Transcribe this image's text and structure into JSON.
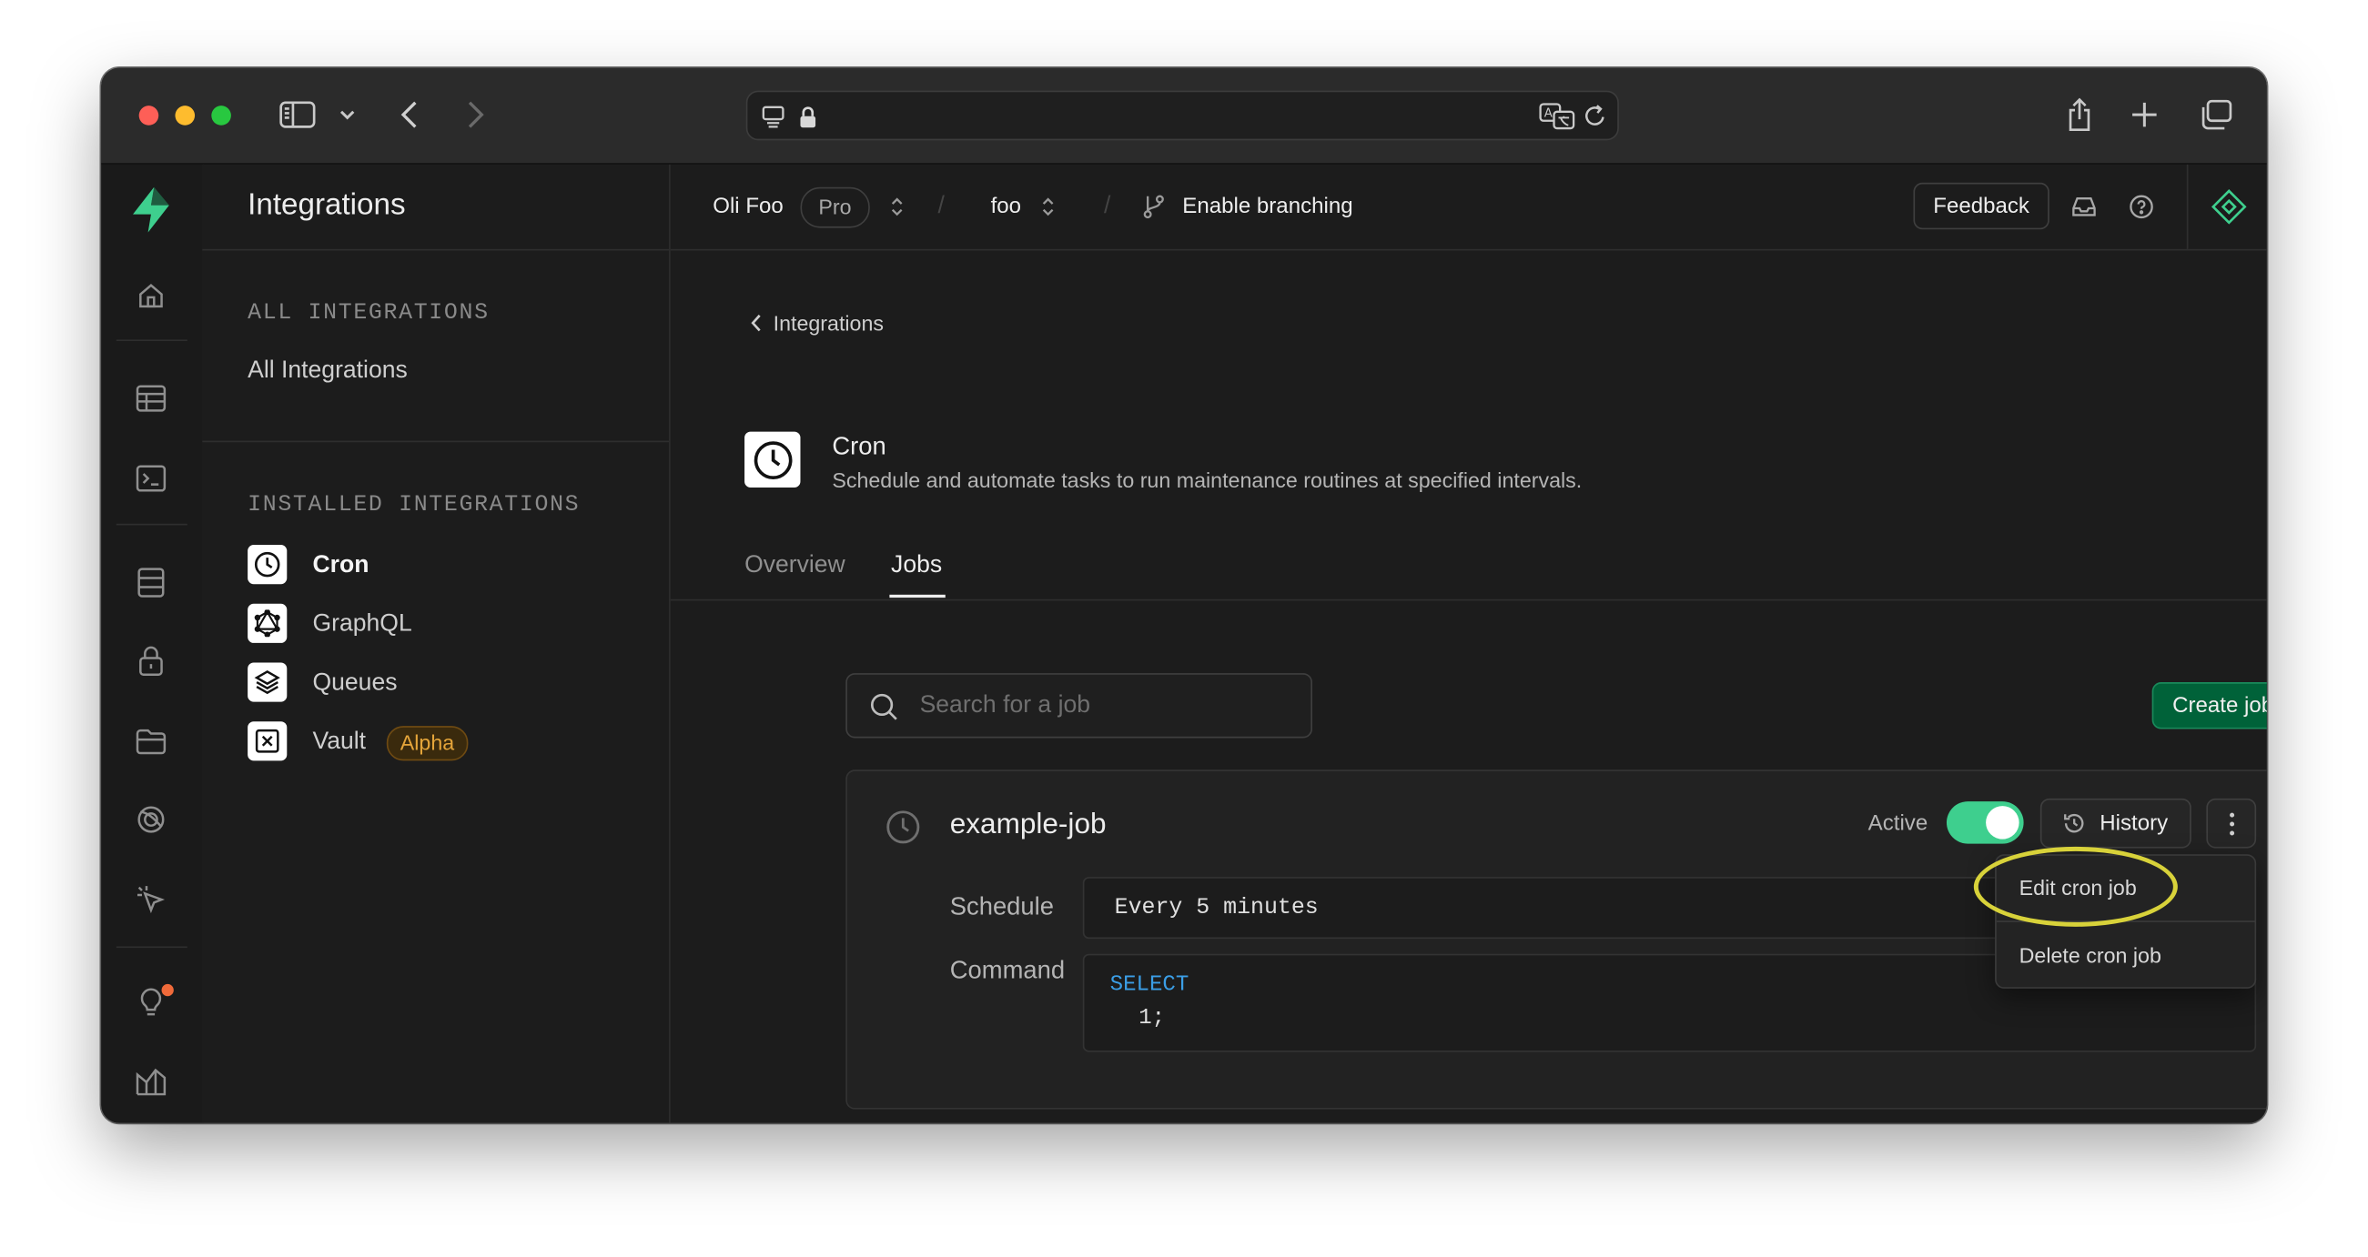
{
  "browser": {
    "toolbar_icons": [
      "sidebar-icon",
      "chevron-down-icon",
      "back-icon",
      "forward-icon",
      "site-icon",
      "lock-icon",
      "translate-icon",
      "reload-icon",
      "share-icon",
      "new-tab-icon",
      "tabs-overview-icon"
    ]
  },
  "rail": {
    "items": [
      "supabase-logo-icon",
      "home-icon",
      "table-editor-icon",
      "sql-editor-icon",
      "database-icon",
      "auth-icon",
      "storage-icon",
      "realtime-icon",
      "edge-functions-icon",
      "advisors-icon",
      "reports-icon"
    ]
  },
  "menu": {
    "title": "Integrations",
    "section_all": "ALL INTEGRATIONS",
    "all_item": "All Integrations",
    "section_installed": "INSTALLED INTEGRATIONS",
    "installed": [
      {
        "label": "Cron",
        "icon": "clock-icon"
      },
      {
        "label": "GraphQL",
        "icon": "graphql-icon"
      },
      {
        "label": "Queues",
        "icon": "layers-icon"
      },
      {
        "label": "Vault",
        "icon": "vault-icon",
        "badge": "Alpha"
      }
    ]
  },
  "topbar": {
    "org": "Oli Foo",
    "plan": "Pro",
    "sep1": "/",
    "project": "foo",
    "sep2": "/",
    "branch_label": "Enable branching",
    "feedback": "Feedback"
  },
  "page": {
    "breadcrumb": "Integrations",
    "integration_title": "Cron",
    "integration_desc": "Schedule and automate tasks to run maintenance routines at specified intervals.",
    "tabs": [
      {
        "label": "Overview",
        "active": false
      },
      {
        "label": "Jobs",
        "active": true
      }
    ],
    "search_placeholder": "Search for a job",
    "create_button": "Create job"
  },
  "job": {
    "name": "example-job",
    "status_label": "Active",
    "active": true,
    "history_button": "History",
    "schedule_label": "Schedule",
    "schedule_value": "Every 5 minutes",
    "command_label": "Command",
    "command_keyword": "SELECT",
    "command_rest": "1;"
  },
  "dropdown": {
    "edit": "Edit cron job",
    "delete": "Delete cron job"
  },
  "colors": {
    "brand_green": "#3ecf8e",
    "create_button_bg": "#006239",
    "alpha_badge": "#e5a53a",
    "highlight_ring": "#d8d23a",
    "sql_keyword": "#3b9ee6"
  }
}
